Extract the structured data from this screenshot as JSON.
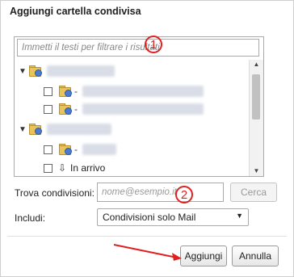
{
  "dialog": {
    "title": "Aggiungi cartella condivisa",
    "filter": {
      "placeholder": "Immetti il testi per filtrare i risultati"
    },
    "tree": {
      "items": [
        {
          "name": "",
          "checkbox": false
        },
        {
          "name": "",
          "checkbox": true
        },
        {
          "name": "",
          "checkbox": true
        },
        {
          "name": "",
          "checkbox": false
        },
        {
          "name": "",
          "checkbox": true
        },
        {
          "name": "In arrivo",
          "checkbox": true
        }
      ]
    },
    "find_shares": {
      "label": "Trova condivisioni:",
      "placeholder": "nome@esempio.it",
      "search_button": "Cerca"
    },
    "include": {
      "label": "Includi:",
      "selected": "Condivisioni solo Mail"
    },
    "buttons": {
      "add": "Aggiungi",
      "cancel": "Annulla"
    },
    "annotations": {
      "marker1": "1",
      "marker2": "2"
    },
    "colors": {
      "annotation_red": "#e02020"
    }
  }
}
